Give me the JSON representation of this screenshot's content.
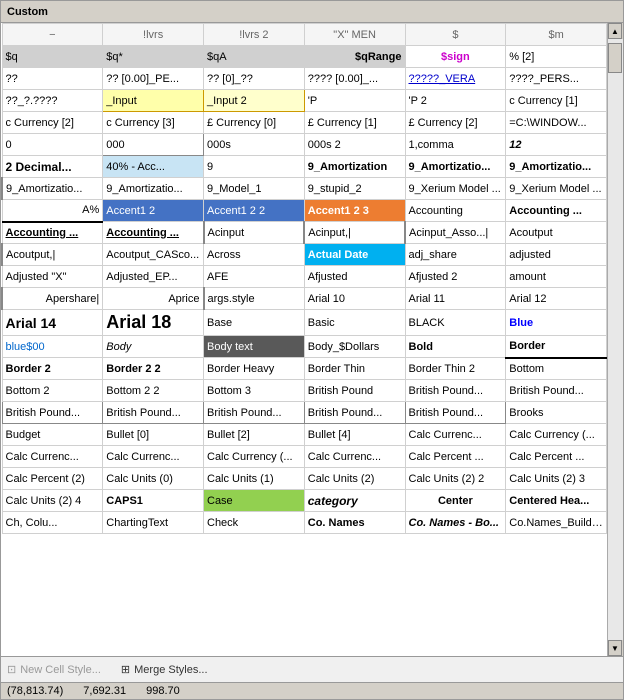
{
  "window": {
    "title": "Custom"
  },
  "grid": {
    "rows": [
      [
        "−",
        "!lvrs",
        "!lvrs 2",
        "\"X\" MEN",
        "$",
        "$m"
      ],
      [
        "$q",
        "$q*",
        "$qA",
        "$qRange",
        "$sign",
        "% [2]"
      ],
      [
        "??",
        "?? [0.00]_PE...",
        "?? [0]_??",
        "???? [0.00]_...",
        "?????_VERA",
        "????_PERS..."
      ],
      [
        "??_?.????",
        "_Input",
        "_Input 2",
        "'P",
        "'P 2",
        "c Currency [1]"
      ],
      [
        "c Currency [2]",
        "c Currency [3]",
        "£ Currency [0]",
        "£ Currency [1]",
        "£ Currency [2]",
        "=C:\\WINDOW..."
      ],
      [
        "0",
        "000",
        "000s",
        "000s 2",
        "1,comma",
        "12"
      ],
      [
        "2 Decimal...",
        "40% - Acc...",
        "9",
        "9_Amortization",
        "9_Amortizatio...",
        "9_Amortizatio..."
      ],
      [
        "9_Amortizatio...",
        "9_Amortizatio...",
        "9_Model_1",
        "9_stupid_2",
        "9_Xerium Model ...",
        "9_Xerium Model ..."
      ],
      [
        "A%",
        "Accent1 2",
        "Accent1 2 2",
        "Accent1 2 3",
        "Accounting",
        "Accounting ..."
      ],
      [
        "Accounting ...",
        "Accounting ...",
        "Acinput",
        "Acinput,|",
        "Acinput_Asso...|",
        "Acoutput"
      ],
      [
        "Acoutput,|",
        "Acoutput_CASco...",
        "Across",
        "Actual Date",
        "adj_share",
        "adjusted"
      ],
      [
        "Adjusted \"X\"",
        "Adjusted_EP...",
        "AFE",
        "Afjusted",
        "Afjusted 2",
        "amount"
      ],
      [
        "Apershare|",
        "Aprice",
        "args.style",
        "Arial 10",
        "Arial 11",
        "Arial 12"
      ],
      [
        "Arial 14",
        "Arial 18",
        "Base",
        "Basic",
        "BLACK",
        "Blue"
      ],
      [
        "blue$00",
        "Body",
        "Body text",
        "Body_$Dollars",
        "Bold",
        "Border"
      ],
      [
        "Border 2",
        "Border 2 2",
        "Border Heavy",
        "Border Thin",
        "Border Thin 2",
        "Bottom"
      ],
      [
        "Bottom 2",
        "Bottom 2 2",
        "Bottom 3",
        "British Pound",
        "British Pound...",
        "British Pound..."
      ],
      [
        "British Pound...",
        "British Pound...",
        "British Pound...",
        "British Pound...",
        "British Pound...",
        "Brooks"
      ],
      [
        "Budget",
        "Bullet [0]",
        "Bullet [2]",
        "Bullet [4]",
        "Calc Currenc...",
        "Calc Currency (..."
      ],
      [
        "Calc Currenc...",
        "Calc Currenc...",
        "Calc Currency (...",
        "Calc Currenc...",
        "Calc Percent ...",
        "Calc Percent ..."
      ],
      [
        "Calc Percent (2)",
        "Calc Units (0)",
        "Calc Units (1)",
        "Calc Units (2)",
        "Calc Units (2) 2",
        "Calc Units (2) 3"
      ],
      [
        "Calc Units (2) 4",
        "CAPS1",
        "Case",
        "category",
        "Center",
        "Centered Hea..."
      ],
      [
        "Ch, Colu...",
        "ChartingText",
        "Check",
        "Co. Names",
        "Co. Names - Bo...",
        "Co.Names_Buildup..."
      ]
    ]
  },
  "bottom_links": [
    {
      "label": "New Cell Style...",
      "disabled": true,
      "icon": "new-icon"
    },
    {
      "label": "Merge Styles...",
      "disabled": false,
      "icon": "merge-icon"
    }
  ],
  "status_bar": {
    "values": [
      "(78,813.74)",
      "7,692.31",
      "998.70"
    ]
  }
}
